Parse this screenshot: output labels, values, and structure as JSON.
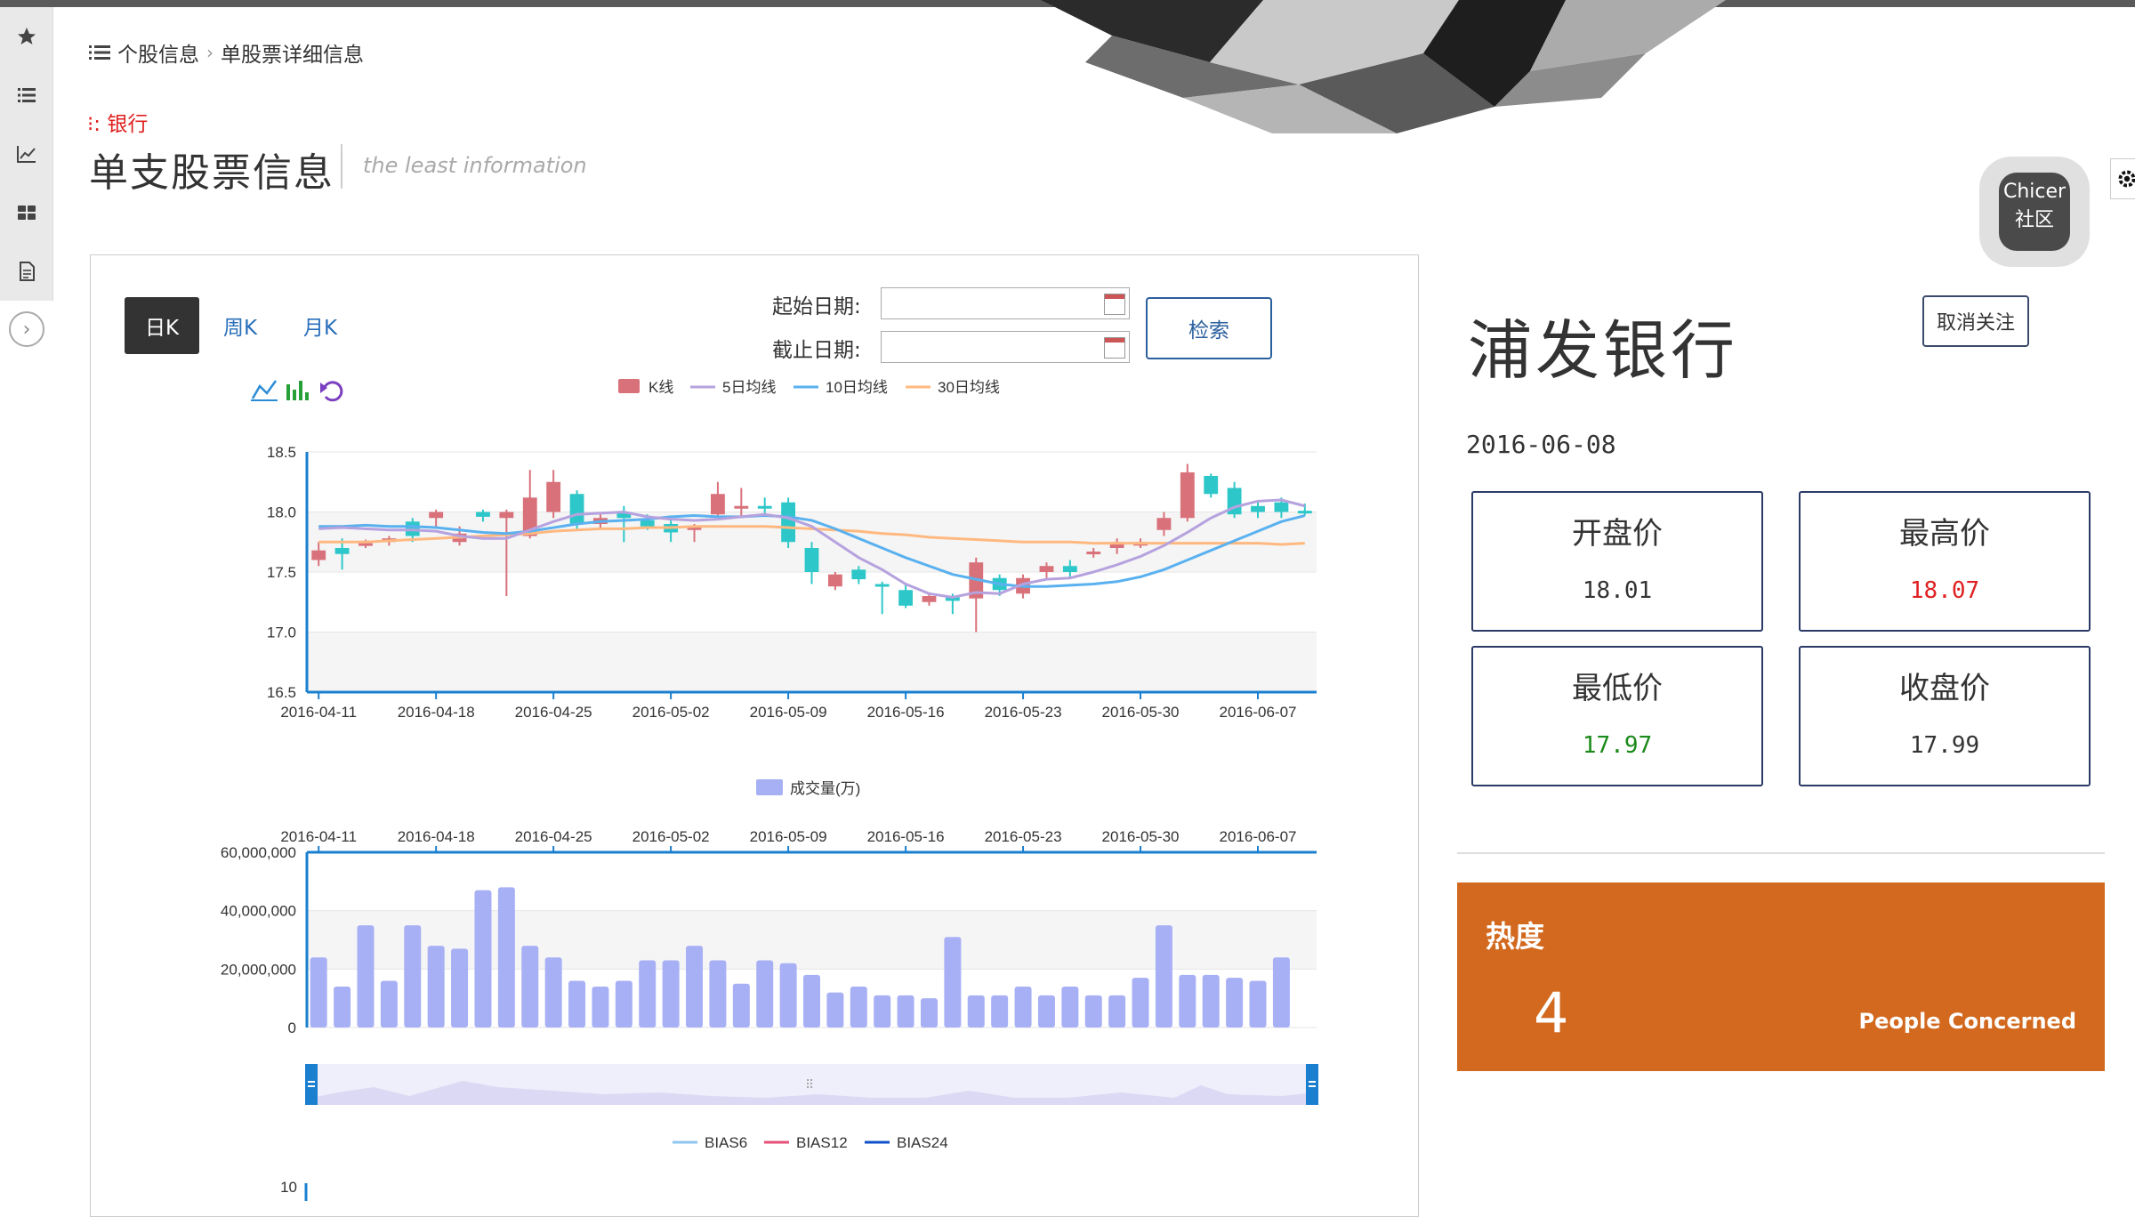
{
  "breadcrumb": {
    "item1": "个股信息",
    "item2": "单股票详细信息"
  },
  "bank_tag": "银行",
  "page_title": "单支股票信息",
  "page_subtitle": "the least information",
  "tabs": {
    "day": "日K",
    "week": "周K",
    "month": "月K"
  },
  "date_filter": {
    "start_label": "起始日期:",
    "end_label": "截止日期:",
    "start_value": "",
    "end_value": "",
    "search_label": "检索"
  },
  "community": {
    "line1": "Chicer",
    "line2": "社区"
  },
  "stock": {
    "name": "浦发银行",
    "unfollow_label": "取消关注",
    "date": "2016-06-08",
    "open_label": "开盘价",
    "open_value": "18.01",
    "high_label": "最高价",
    "high_value": "18.07",
    "low_label": "最低价",
    "low_value": "17.97",
    "close_label": "收盘价",
    "close_value": "17.99"
  },
  "heat": {
    "label": "热度",
    "value": "4",
    "caption": "People Concerned"
  },
  "colors": {
    "up": "#d9717a",
    "down": "#2ec7c9",
    "ma5": "#b6a2de",
    "ma10": "#5ab1ef",
    "ma30": "#ffb980",
    "volume": "#a8b0f5",
    "heat_bg": "#d2691e",
    "high_value": "#e02020",
    "low_value": "#1a8a1a"
  },
  "chart_data": [
    {
      "type": "candlestick",
      "legend": [
        "K线",
        "5日均线",
        "10日均线",
        "30日均线"
      ],
      "ylim": [
        16.5,
        18.5
      ],
      "yticks": [
        "18.5",
        "18.0",
        "17.5",
        "17.0",
        "16.5"
      ],
      "xticks": [
        "2016-04-11",
        "2016-04-18",
        "2016-04-25",
        "2016-05-02",
        "2016-05-09",
        "2016-05-16",
        "2016-05-23",
        "2016-05-30",
        "2016-06-07"
      ],
      "candles": [
        [
          17.6,
          17.68,
          17.55,
          17.75
        ],
        [
          17.7,
          17.65,
          17.52,
          17.78
        ],
        [
          17.73,
          17.74,
          17.7,
          17.77
        ],
        [
          17.75,
          17.78,
          17.72,
          17.8
        ],
        [
          17.92,
          17.8,
          17.75,
          17.95
        ],
        [
          17.95,
          18.0,
          17.88,
          18.02
        ],
        [
          17.75,
          17.82,
          17.72,
          17.88
        ],
        [
          18.0,
          17.96,
          17.92,
          18.02
        ],
        [
          17.95,
          18.0,
          17.3,
          18.02
        ],
        [
          17.8,
          18.12,
          17.78,
          18.35
        ],
        [
          18.0,
          18.25,
          17.95,
          18.35
        ],
        [
          18.15,
          17.9,
          17.85,
          18.18
        ],
        [
          17.9,
          17.95,
          17.85,
          18.0
        ],
        [
          18.0,
          17.95,
          17.75,
          18.05
        ],
        [
          17.93,
          17.88,
          17.85,
          17.98
        ],
        [
          17.9,
          17.83,
          17.75,
          17.95
        ],
        [
          17.85,
          17.88,
          17.75,
          17.9
        ],
        [
          17.98,
          18.15,
          17.95,
          18.25
        ],
        [
          18.03,
          18.05,
          17.95,
          18.2
        ],
        [
          18.05,
          18.03,
          17.98,
          18.12
        ],
        [
          18.08,
          17.75,
          17.7,
          18.12
        ],
        [
          17.7,
          17.5,
          17.4,
          17.75
        ],
        [
          17.38,
          17.48,
          17.35,
          17.5
        ],
        [
          17.52,
          17.44,
          17.4,
          17.55
        ],
        [
          17.4,
          17.38,
          17.15,
          17.42
        ],
        [
          17.35,
          17.22,
          17.2,
          17.4
        ],
        [
          17.25,
          17.3,
          17.22,
          17.33
        ],
        [
          17.3,
          17.26,
          17.15,
          17.32
        ],
        [
          17.28,
          17.58,
          17.0,
          17.62
        ],
        [
          17.45,
          17.35,
          17.3,
          17.48
        ],
        [
          17.32,
          17.45,
          17.28,
          17.48
        ],
        [
          17.5,
          17.55,
          17.45,
          17.58
        ],
        [
          17.55,
          17.5,
          17.45,
          17.6
        ],
        [
          17.67,
          17.67,
          17.62,
          17.7
        ],
        [
          17.7,
          17.75,
          17.65,
          17.78
        ],
        [
          17.72,
          17.75,
          17.7,
          17.78
        ],
        [
          17.85,
          17.95,
          17.8,
          18.0
        ],
        [
          17.95,
          18.33,
          17.92,
          18.4
        ],
        [
          18.3,
          18.15,
          18.12,
          18.32
        ],
        [
          18.2,
          17.98,
          17.95,
          18.25
        ],
        [
          18.05,
          18.0,
          17.95,
          18.08
        ],
        [
          18.08,
          18.0,
          17.95,
          18.12
        ],
        [
          18.01,
          17.99,
          17.97,
          18.07
        ]
      ],
      "ma5": [
        17.86,
        17.87,
        17.86,
        17.85,
        17.85,
        17.84,
        17.8,
        17.78,
        17.78,
        17.85,
        17.92,
        17.98,
        17.99,
        18.0,
        17.96,
        17.94,
        17.93,
        17.94,
        17.96,
        17.98,
        17.95,
        17.88,
        17.75,
        17.62,
        17.52,
        17.4,
        17.32,
        17.29,
        17.33,
        17.32,
        17.4,
        17.44,
        17.45,
        17.5,
        17.56,
        17.63,
        17.72,
        17.83,
        17.95,
        18.04,
        18.09,
        18.1,
        18.05
      ],
      "ma10": [
        17.88,
        17.88,
        17.89,
        17.88,
        17.88,
        17.87,
        17.85,
        17.83,
        17.82,
        17.84,
        17.87,
        17.9,
        17.92,
        17.93,
        17.94,
        17.96,
        17.97,
        17.96,
        17.96,
        17.97,
        17.96,
        17.93,
        17.86,
        17.78,
        17.7,
        17.62,
        17.55,
        17.48,
        17.44,
        17.4,
        17.38,
        17.38,
        17.39,
        17.4,
        17.42,
        17.46,
        17.52,
        17.6,
        17.68,
        17.76,
        17.84,
        17.92,
        17.97
      ],
      "ma30": [
        17.75,
        17.75,
        17.75,
        17.76,
        17.77,
        17.78,
        17.79,
        17.8,
        17.81,
        17.82,
        17.84,
        17.85,
        17.86,
        17.86,
        17.87,
        17.87,
        17.88,
        17.88,
        17.88,
        17.88,
        17.87,
        17.86,
        17.85,
        17.84,
        17.82,
        17.81,
        17.79,
        17.78,
        17.77,
        17.76,
        17.75,
        17.75,
        17.75,
        17.74,
        17.74,
        17.74,
        17.74,
        17.74,
        17.74,
        17.74,
        17.74,
        17.73,
        17.74
      ]
    },
    {
      "type": "bar",
      "legend": [
        "成交量(万)"
      ],
      "ylim": [
        0,
        60000000
      ],
      "yticks": [
        "60,000,000",
        "40,000,000",
        "20,000,000",
        "0"
      ],
      "xticks": [
        "2016-04-11",
        "2016-04-18",
        "2016-04-25",
        "2016-05-02",
        "2016-05-09",
        "2016-05-16",
        "2016-05-23",
        "2016-05-30",
        "2016-06-07"
      ],
      "values": [
        24000000,
        14000000,
        35000000,
        16000000,
        35000000,
        28000000,
        27000000,
        47000000,
        48000000,
        28000000,
        24000000,
        16000000,
        14000000,
        16000000,
        23000000,
        23000000,
        28000000,
        23000000,
        15000000,
        23000000,
        22000000,
        18000000,
        12000000,
        14000000,
        11000000,
        11000000,
        10000000,
        31000000,
        11000000,
        11000000,
        14000000,
        11000000,
        14000000,
        11000000,
        11000000,
        17000000,
        35000000,
        18000000,
        18000000,
        17000000,
        16000000,
        24000000
      ]
    },
    {
      "type": "line",
      "legend": [
        "BIAS6",
        "BIAS12",
        "BIAS24"
      ],
      "yticks": [
        "10"
      ]
    }
  ]
}
